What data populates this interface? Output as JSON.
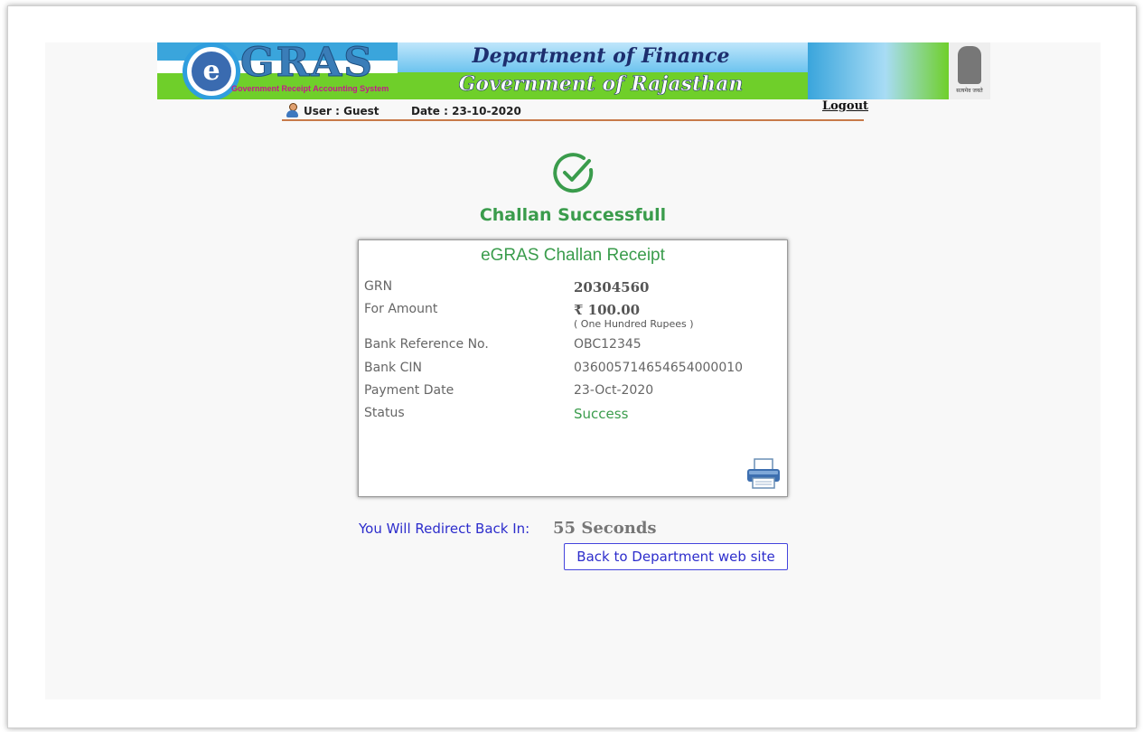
{
  "header": {
    "logo_letter": "e",
    "logo_text": "GRAS",
    "logo_subtitle": "Government Receipt Accounting System",
    "dept_line1": "Department of Finance",
    "dept_line2": "Government of Rajasthan",
    "emblem_caption": "सत्यमेव जयते"
  },
  "userbar": {
    "user": "User : Guest",
    "date": "Date : 23-10-2020",
    "logout": "Logout"
  },
  "status": {
    "icon": "check-circle-icon",
    "title": "Challan Successfull",
    "color": "#3a9c4c"
  },
  "receipt": {
    "title": "eGRAS Challan Receipt",
    "rows": [
      {
        "label": "GRN",
        "value": "20304560"
      },
      {
        "label": "For Amount",
        "value": "₹ 100.00",
        "words": "( One Hundred Rupees )"
      },
      {
        "label": "Bank Reference No.",
        "value": "OBC12345"
      },
      {
        "label": "Bank CIN",
        "value": "03600571465465400001​0"
      },
      {
        "label": "Payment Date",
        "value": "23-Oct-2020"
      },
      {
        "label": "Status",
        "value": "Success"
      }
    ],
    "print_icon": "printer-icon"
  },
  "redirect": {
    "text": "You Will Redirect Back In:",
    "seconds": "55 Seconds",
    "back_button": "Back to Department web site"
  }
}
